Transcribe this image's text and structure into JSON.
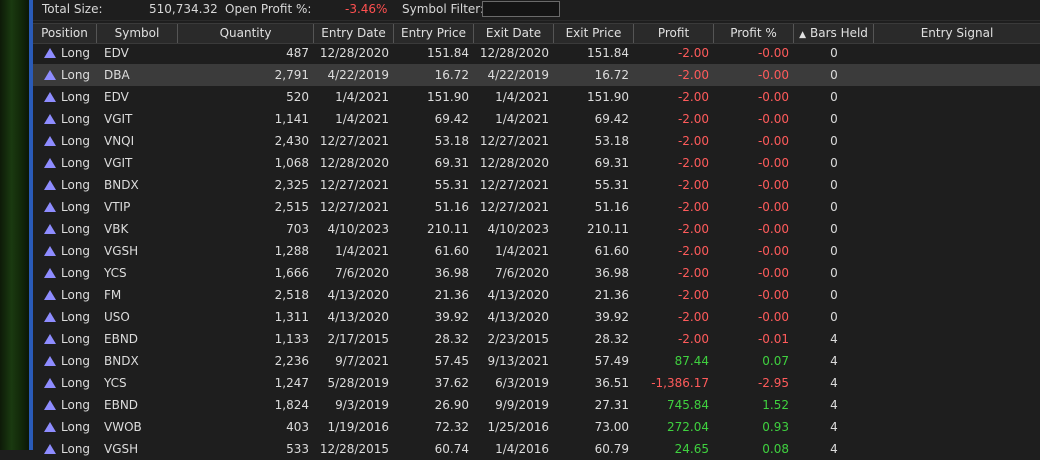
{
  "summary": {
    "total_size_label": "Total Size:",
    "total_size_value": "510,734.32",
    "open_profit_label": "Open Profit %:",
    "open_profit_value": "-3.46%",
    "symbol_filter_label": "Symbol Filter:",
    "symbol_filter_value": ""
  },
  "columns": {
    "position": "Position",
    "symbol": "Symbol",
    "quantity": "Quantity",
    "entry_date": "Entry Date",
    "entry_price": "Entry Price",
    "exit_date": "Exit Date",
    "exit_price": "Exit Price",
    "profit": "Profit",
    "profit_pct": "Profit %",
    "bars_held": "Bars Held",
    "entry_signal": "Entry Signal"
  },
  "sort_indicator": "up-triangle-icon",
  "rows": [
    {
      "position": "Long",
      "symbol": "EDV",
      "quantity": "487",
      "entry_date": "12/28/2020",
      "entry_price": "151.84",
      "exit_date": "12/28/2020",
      "exit_price": "151.84",
      "profit": "-2.00",
      "profit_pct": "-0.00",
      "bars_held": "0",
      "entry_signal": ""
    },
    {
      "position": "Long",
      "symbol": "DBA",
      "quantity": "2,791",
      "entry_date": "4/22/2019",
      "entry_price": "16.72",
      "exit_date": "4/22/2019",
      "exit_price": "16.72",
      "profit": "-2.00",
      "profit_pct": "-0.00",
      "bars_held": "0",
      "entry_signal": ""
    },
    {
      "position": "Long",
      "symbol": "EDV",
      "quantity": "520",
      "entry_date": "1/4/2021",
      "entry_price": "151.90",
      "exit_date": "1/4/2021",
      "exit_price": "151.90",
      "profit": "-2.00",
      "profit_pct": "-0.00",
      "bars_held": "0",
      "entry_signal": ""
    },
    {
      "position": "Long",
      "symbol": "VGIT",
      "quantity": "1,141",
      "entry_date": "1/4/2021",
      "entry_price": "69.42",
      "exit_date": "1/4/2021",
      "exit_price": "69.42",
      "profit": "-2.00",
      "profit_pct": "-0.00",
      "bars_held": "0",
      "entry_signal": ""
    },
    {
      "position": "Long",
      "symbol": "VNQI",
      "quantity": "2,430",
      "entry_date": "12/27/2021",
      "entry_price": "53.18",
      "exit_date": "12/27/2021",
      "exit_price": "53.18",
      "profit": "-2.00",
      "profit_pct": "-0.00",
      "bars_held": "0",
      "entry_signal": ""
    },
    {
      "position": "Long",
      "symbol": "VGIT",
      "quantity": "1,068",
      "entry_date": "12/28/2020",
      "entry_price": "69.31",
      "exit_date": "12/28/2020",
      "exit_price": "69.31",
      "profit": "-2.00",
      "profit_pct": "-0.00",
      "bars_held": "0",
      "entry_signal": ""
    },
    {
      "position": "Long",
      "symbol": "BNDX",
      "quantity": "2,325",
      "entry_date": "12/27/2021",
      "entry_price": "55.31",
      "exit_date": "12/27/2021",
      "exit_price": "55.31",
      "profit": "-2.00",
      "profit_pct": "-0.00",
      "bars_held": "0",
      "entry_signal": ""
    },
    {
      "position": "Long",
      "symbol": "VTIP",
      "quantity": "2,515",
      "entry_date": "12/27/2021",
      "entry_price": "51.16",
      "exit_date": "12/27/2021",
      "exit_price": "51.16",
      "profit": "-2.00",
      "profit_pct": "-0.00",
      "bars_held": "0",
      "entry_signal": ""
    },
    {
      "position": "Long",
      "symbol": "VBK",
      "quantity": "703",
      "entry_date": "4/10/2023",
      "entry_price": "210.11",
      "exit_date": "4/10/2023",
      "exit_price": "210.11",
      "profit": "-2.00",
      "profit_pct": "-0.00",
      "bars_held": "0",
      "entry_signal": ""
    },
    {
      "position": "Long",
      "symbol": "VGSH",
      "quantity": "1,288",
      "entry_date": "1/4/2021",
      "entry_price": "61.60",
      "exit_date": "1/4/2021",
      "exit_price": "61.60",
      "profit": "-2.00",
      "profit_pct": "-0.00",
      "bars_held": "0",
      "entry_signal": ""
    },
    {
      "position": "Long",
      "symbol": "YCS",
      "quantity": "1,666",
      "entry_date": "7/6/2020",
      "entry_price": "36.98",
      "exit_date": "7/6/2020",
      "exit_price": "36.98",
      "profit": "-2.00",
      "profit_pct": "-0.00",
      "bars_held": "0",
      "entry_signal": ""
    },
    {
      "position": "Long",
      "symbol": "FM",
      "quantity": "2,518",
      "entry_date": "4/13/2020",
      "entry_price": "21.36",
      "exit_date": "4/13/2020",
      "exit_price": "21.36",
      "profit": "-2.00",
      "profit_pct": "-0.00",
      "bars_held": "0",
      "entry_signal": ""
    },
    {
      "position": "Long",
      "symbol": "USO",
      "quantity": "1,311",
      "entry_date": "4/13/2020",
      "entry_price": "39.92",
      "exit_date": "4/13/2020",
      "exit_price": "39.92",
      "profit": "-2.00",
      "profit_pct": "-0.00",
      "bars_held": "0",
      "entry_signal": ""
    },
    {
      "position": "Long",
      "symbol": "EBND",
      "quantity": "1,133",
      "entry_date": "2/17/2015",
      "entry_price": "28.32",
      "exit_date": "2/23/2015",
      "exit_price": "28.32",
      "profit": "-2.00",
      "profit_pct": "-0.01",
      "bars_held": "4",
      "entry_signal": ""
    },
    {
      "position": "Long",
      "symbol": "BNDX",
      "quantity": "2,236",
      "entry_date": "9/7/2021",
      "entry_price": "57.45",
      "exit_date": "9/13/2021",
      "exit_price": "57.49",
      "profit": "87.44",
      "profit_pct": "0.07",
      "bars_held": "4",
      "entry_signal": ""
    },
    {
      "position": "Long",
      "symbol": "YCS",
      "quantity": "1,247",
      "entry_date": "5/28/2019",
      "entry_price": "37.62",
      "exit_date": "6/3/2019",
      "exit_price": "36.51",
      "profit": "-1,386.17",
      "profit_pct": "-2.95",
      "bars_held": "4",
      "entry_signal": ""
    },
    {
      "position": "Long",
      "symbol": "EBND",
      "quantity": "1,824",
      "entry_date": "9/3/2019",
      "entry_price": "26.90",
      "exit_date": "9/9/2019",
      "exit_price": "27.31",
      "profit": "745.84",
      "profit_pct": "1.52",
      "bars_held": "4",
      "entry_signal": ""
    },
    {
      "position": "Long",
      "symbol": "VWOB",
      "quantity": "403",
      "entry_date": "1/19/2016",
      "entry_price": "72.32",
      "exit_date": "1/25/2016",
      "exit_price": "73.00",
      "profit": "272.04",
      "profit_pct": "0.93",
      "bars_held": "4",
      "entry_signal": ""
    },
    {
      "position": "Long",
      "symbol": "VGSH",
      "quantity": "533",
      "entry_date": "12/28/2015",
      "entry_price": "60.74",
      "exit_date": "1/4/2016",
      "exit_price": "60.79",
      "profit": "24.65",
      "profit_pct": "0.08",
      "bars_held": "4",
      "entry_signal": ""
    }
  ],
  "selected_row_index": 1,
  "colors": {
    "negative": "#ff5b5b",
    "positive": "#3fd13f",
    "long_icon": "#8e8cff",
    "background": "#1e1e1e",
    "selected_row": "#3b3b3b"
  }
}
